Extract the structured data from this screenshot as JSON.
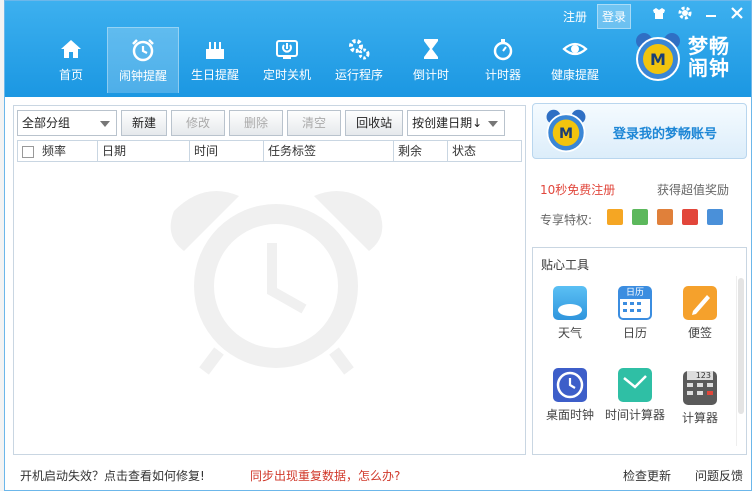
{
  "header": {
    "register_label": "注册",
    "login_label": "登录",
    "brand": "梦畅闹钟",
    "nav": [
      {
        "label": "首页",
        "icon": "home-icon"
      },
      {
        "label": "闹钟提醒",
        "icon": "alarm-clock-icon",
        "active": true
      },
      {
        "label": "生日提醒",
        "icon": "birthday-cake-icon"
      },
      {
        "label": "定时关机",
        "icon": "power-icon"
      },
      {
        "label": "运行程序",
        "icon": "gear-icon"
      },
      {
        "label": "倒计时",
        "icon": "hourglass-icon"
      },
      {
        "label": "计时器",
        "icon": "stopwatch-icon"
      },
      {
        "label": "健康提醒",
        "icon": "eye-icon"
      }
    ],
    "window_controls": [
      "skin-icon",
      "settings-icon",
      "minimize-icon",
      "close-icon"
    ]
  },
  "toolbar": {
    "group_select": "全部分组",
    "new_label": "新建",
    "edit_label": "修改",
    "delete_label": "删除",
    "clear_label": "清空",
    "recycle_label": "回收站",
    "sort_select": "按创建日期↓"
  },
  "table": {
    "columns": [
      "频率",
      "日期",
      "时间",
      "任务标签",
      "剩余",
      "状态"
    ]
  },
  "account": {
    "label": "登录我的梦畅账号",
    "register_promo": "10秒免费注册",
    "reward": "获得超值奖励",
    "privileges_label": "专享特权:"
  },
  "tools": {
    "title": "贴心工具",
    "items": [
      {
        "label": "天气",
        "icon": "weather-icon"
      },
      {
        "label": "日历",
        "icon": "calendar-icon",
        "sub": "日历"
      },
      {
        "label": "便签",
        "icon": "note-icon"
      },
      {
        "label": "桌面时钟",
        "icon": "desktop-clock-icon"
      },
      {
        "label": "时间计算器",
        "icon": "time-calculator-icon"
      },
      {
        "label": "计算器",
        "icon": "calculator-icon",
        "sub": "123"
      }
    ]
  },
  "status": {
    "boot_fail": "开机启动失效？点击查看如何修复!",
    "sync_dup": "同步出现重复数据，怎么办?",
    "check_update": "检查更新",
    "feedback": "问题反馈"
  },
  "colors": {
    "header_blue": "#1b97e2",
    "accent_blue": "#1e87d6",
    "promo_red": "#e1473c",
    "warn_red": "#d0392b"
  }
}
